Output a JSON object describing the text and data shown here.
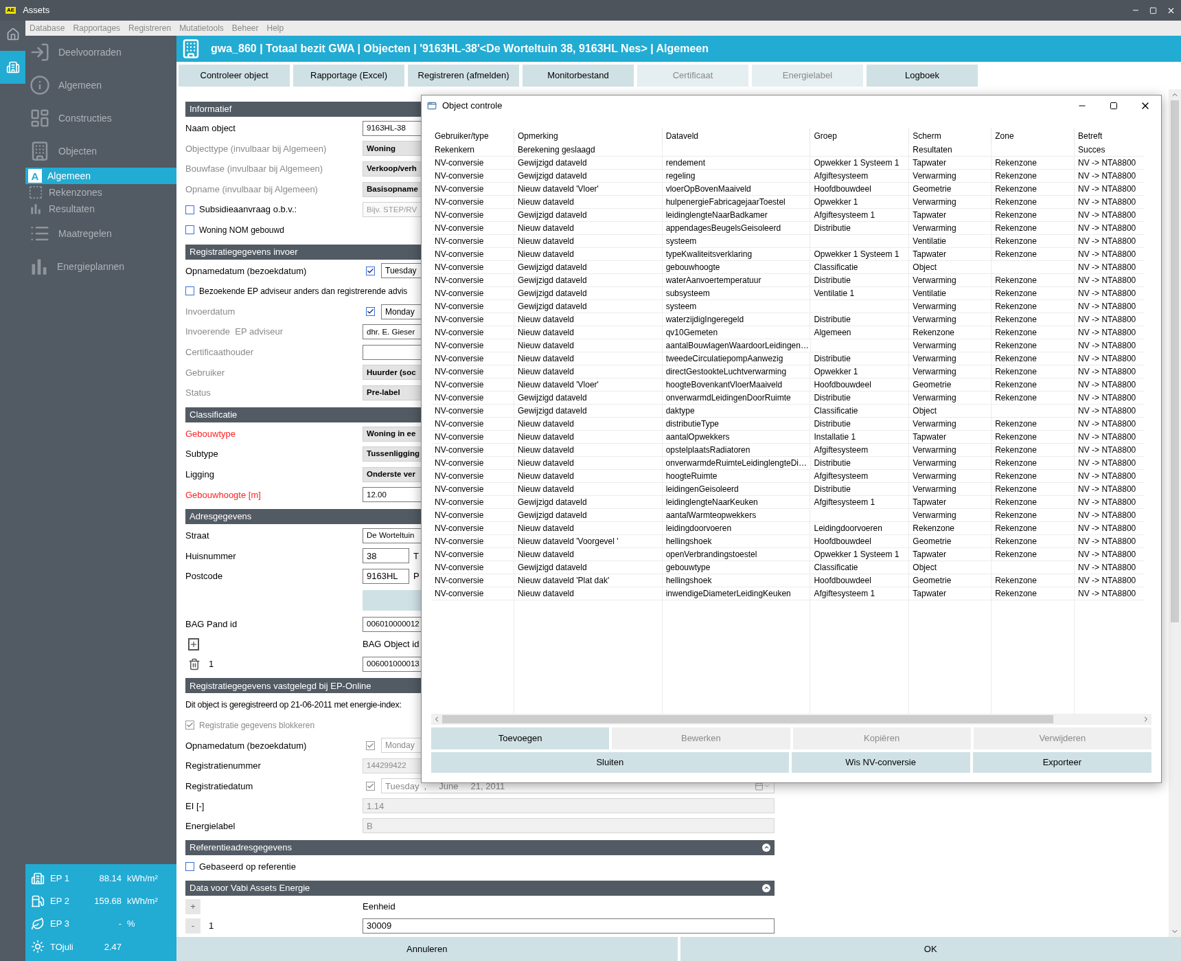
{
  "window": {
    "logo": "AE",
    "title": "Assets"
  },
  "menu": [
    "Database",
    "Rapportages",
    "Registreren",
    "Mutatietools",
    "Beheer",
    "Help"
  ],
  "nav_strip": [
    {
      "selected": false
    },
    {
      "selected": true
    }
  ],
  "sidebar": {
    "items": [
      {
        "label": "Deelvoorraden",
        "selected": false
      },
      {
        "label": "Algemeen",
        "selected": false
      },
      {
        "label": "Constructies",
        "selected": false
      },
      {
        "label": "Objecten",
        "selected": false,
        "children": [
          {
            "label": "Algemeen",
            "icon_letter": "A",
            "selected": true
          },
          {
            "label": "Rekenzones",
            "selected": false
          },
          {
            "label": "Resultaten",
            "selected": false
          }
        ]
      },
      {
        "label": "Maatregelen",
        "selected": false
      },
      {
        "label": "Energieplannen",
        "selected": false
      }
    ],
    "indicators": [
      {
        "label": "EP 1",
        "value": "88.14",
        "unit": "kWh/m²"
      },
      {
        "label": "EP 2",
        "value": "159.68",
        "unit": "kWh/m²"
      },
      {
        "label": "EP 3",
        "value": "-",
        "unit": "%"
      },
      {
        "label": "TOjuli",
        "value": "2.47"
      }
    ]
  },
  "header": {
    "title": "gwa_860 | Totaal bezit GWA | Objecten | '9163HL-38'<De Worteltuin 38, 9163HL Nes> | Algemeen"
  },
  "toolbar": [
    {
      "label": "Controleer object",
      "disabled": false
    },
    {
      "label": "Rapportage (Excel)",
      "disabled": false
    },
    {
      "label": "Registreren (afmelden)",
      "disabled": false
    },
    {
      "label": "Monitorbestand",
      "disabled": false
    },
    {
      "label": "Certificaat",
      "disabled": true
    },
    {
      "label": "Energielabel",
      "disabled": true
    },
    {
      "label": "Logboek",
      "disabled": false
    }
  ],
  "form": {
    "upper": [
      {
        "kind": "header",
        "title": "Informatief",
        "collapsible": false
      },
      {
        "kind": "text_field",
        "label": "Naam object",
        "required": false,
        "muted": false,
        "value": "9163HL-38"
      },
      {
        "kind": "select_field",
        "label": "Objecttype (invulbaar bij Algemeen)",
        "required": false,
        "muted": true,
        "value": "Woning"
      },
      {
        "kind": "select_field",
        "label": "Bouwfase (invulbaar bij Algemeen)",
        "required": false,
        "muted": true,
        "value": "Verkoop/verh"
      },
      {
        "kind": "select_field",
        "label": "Opname (invulbaar bij Algemeen)",
        "required": false,
        "muted": true,
        "value": "Basisopname"
      },
      {
        "kind": "check",
        "label": "Subsidieaanvraag o.b.v.:",
        "checked": false,
        "disabled": false,
        "placeholder": "Bijv. STEP/RV"
      },
      {
        "kind": "check",
        "label": "Woning NOM gebouwd",
        "checked": false,
        "disabled": false
      },
      {
        "kind": "header",
        "title": "Registratiegegevens invoer",
        "collapsible": false
      },
      {
        "kind": "date",
        "label": "Opnamedatum (bezoekdatum)",
        "required": false,
        "muted": false,
        "checked": true,
        "disabled": false,
        "value": "Tuesday"
      },
      {
        "kind": "check",
        "label": "Bezoekende EP adviseur anders dan registrerende advis",
        "checked": false,
        "disabled": false
      },
      {
        "kind": "date",
        "label": "Invoerdatum",
        "required": false,
        "muted": true,
        "checked": true,
        "disabled": false,
        "value": "Monday"
      },
      {
        "kind": "text_field",
        "label": "Invoerende  EP adviseur",
        "required": false,
        "muted": true,
        "value": "dhr. E. Gieser"
      },
      {
        "kind": "text_field",
        "label": "Certificaathouder",
        "required": false,
        "muted": true
      },
      {
        "kind": "select_field",
        "label": "Gebruiker",
        "required": false,
        "muted": true,
        "value": "Huurder (soc"
      },
      {
        "kind": "select_field",
        "label": "Status",
        "required": false,
        "muted": true,
        "value": "Pre-label"
      },
      {
        "kind": "header",
        "title": "Classificatie",
        "collapsible": false
      },
      {
        "kind": "select_field",
        "label": "Gebouwtype",
        "required": true,
        "muted": false,
        "value": "Woning in ee"
      },
      {
        "kind": "select_field",
        "label": "Subtype",
        "required": false,
        "muted": false,
        "value": "Tussenligging"
      },
      {
        "kind": "select_field",
        "label": "Ligging",
        "required": false,
        "muted": false,
        "value": "Onderste ver"
      },
      {
        "kind": "text_field",
        "label": "Gebouwhoogte [m]",
        "required": true,
        "muted": false,
        "value": "12.00"
      },
      {
        "kind": "header",
        "title": "Adresgegevens",
        "collapsible": false
      },
      {
        "kind": "text_field",
        "label": "Straat",
        "required": false,
        "muted": false,
        "value": "De Worteltuin"
      },
      {
        "kind": "short_field",
        "label": "Huisnummer",
        "required": false,
        "muted": false,
        "value": "38",
        "after": "T"
      },
      {
        "kind": "short_field",
        "label": "Postcode",
        "required": false,
        "muted": false,
        "value": "9163HL",
        "after": "P"
      },
      {
        "kind": "blank_button"
      },
      {
        "kind": "text_field",
        "label": "BAG Pand id",
        "required": false,
        "muted": false,
        "value": "006010000012"
      },
      {
        "kind": "add",
        "label": "BAG Object id"
      },
      {
        "kind": "remove",
        "label": "1",
        "value": "006001000013"
      },
      {
        "kind": "header",
        "title": "Registratiegegevens vastgelegd bij EP-Online",
        "collapsible": false
      },
      {
        "kind": "note",
        "text": "Dit object is geregistreerd op 21-06-2011 met energie-index:"
      },
      {
        "kind": "check",
        "label": "Registratie gegevens blokkeren",
        "checked": true,
        "disabled": true
      },
      {
        "kind": "date",
        "label": "Opnamedatum (bezoekdatum)",
        "required": false,
        "muted": false,
        "checked": true,
        "disabled": true,
        "value": "Monday"
      },
      {
        "kind": "readonly_field",
        "label": "Registratienummer",
        "required": false,
        "muted": false,
        "value": "144299422"
      }
    ],
    "lower": [
      {
        "kind": "date",
        "label": "Registratiedatum",
        "required": false,
        "muted": false,
        "checked": true,
        "disabled": true,
        "value": "Tuesday  ,     June     21, 2011"
      },
      {
        "kind": "readonly_field",
        "label": "EI [-]",
        "required": false,
        "muted": false,
        "value": "1.14"
      },
      {
        "kind": "readonly_field",
        "label": "Energielabel",
        "required": false,
        "muted": false,
        "value": "B"
      },
      {
        "kind": "header",
        "title": "Referentieadresgegevens",
        "collapsible": true
      },
      {
        "kind": "check",
        "label": "Gebaseerd op referentie",
        "checked": false,
        "disabled": false
      },
      {
        "kind": "header",
        "title": "Data voor Vabi Assets Energie",
        "collapsible": true
      },
      {
        "kind": "symbol_row",
        "symbol": "+",
        "label": "Eenheid"
      },
      {
        "kind": "symbol_row",
        "symbol": "-",
        "label": "1",
        "value": "30009"
      }
    ]
  },
  "footer": [
    "Annuleren",
    "OK"
  ],
  "dialog": {
    "title": "Object controle",
    "columns": [
      "Gebruiker/type",
      "Opmerking",
      "Dataveld",
      "Groep",
      "Scherm",
      "Zone",
      "Betreft"
    ],
    "rows": [
      {
        "gebruiker_type": "Rekenkern",
        "opmerking": "Berekening geslaagd",
        "scherm": "Resultaten",
        "betreft": "Succes"
      },
      {
        "gebruiker_type": "NV-conversie",
        "opmerking": "Gewijzigd dataveld",
        "dataveld": "rendement",
        "groep": "Opwekker 1 Systeem 1",
        "scherm": "Tapwater",
        "zone": "Rekenzone",
        "betreft": "NV -> NTA8800"
      },
      {
        "gebruiker_type": "NV-conversie",
        "opmerking": "Gewijzigd dataveld",
        "dataveld": "regeling",
        "groep": "Afgiftesysteem",
        "scherm": "Verwarming",
        "zone": "Rekenzone",
        "betreft": "NV -> NTA8800"
      },
      {
        "gebruiker_type": "NV-conversie",
        "opmerking": "Nieuw dataveld 'Vloer'",
        "dataveld": "vloerOpBovenMaaiveld",
        "groep": "Hoofdbouwdeel",
        "scherm": "Geometrie",
        "zone": "Rekenzone",
        "betreft": "NV -> NTA8800"
      },
      {
        "gebruiker_type": "NV-conversie",
        "opmerking": "Nieuw dataveld",
        "dataveld": "hulpenergieFabricagejaarToestel",
        "groep": "Opwekker 1",
        "scherm": "Verwarming",
        "zone": "Rekenzone",
        "betreft": "NV -> NTA8800"
      },
      {
        "gebruiker_type": "NV-conversie",
        "opmerking": "Gewijzigd dataveld",
        "dataveld": "leidinglengteNaarBadkamer",
        "groep": "Afgiftesysteem 1",
        "scherm": "Tapwater",
        "zone": "Rekenzone",
        "betreft": "NV -> NTA8800"
      },
      {
        "gebruiker_type": "NV-conversie",
        "opmerking": "Nieuw dataveld",
        "dataveld": "appendagesBeugelsGeisoleerd",
        "groep": "Distributie",
        "scherm": "Verwarming",
        "zone": "Rekenzone",
        "betreft": "NV -> NTA8800"
      },
      {
        "gebruiker_type": "NV-conversie",
        "opmerking": "Nieuw dataveld",
        "dataveld": "systeem",
        "scherm": "Ventilatie",
        "zone": "Rekenzone",
        "betreft": "NV -> NTA8800"
      },
      {
        "gebruiker_type": "NV-conversie",
        "opmerking": "Nieuw dataveld",
        "dataveld": "typeKwaliteitsverklaring",
        "groep": "Opwekker 1 Systeem 1",
        "scherm": "Tapwater",
        "zone": "Rekenzone",
        "betreft": "NV -> NTA8800"
      },
      {
        "gebruiker_type": "NV-conversie",
        "opmerking": "Gewijzigd dataveld",
        "dataveld": "gebouwhoogte",
        "groep": "Classificatie",
        "scherm": "Object",
        "betreft": "NV -> NTA8800"
      },
      {
        "gebruiker_type": "NV-conversie",
        "opmerking": "Gewijzigd dataveld",
        "dataveld": "waterAanvoertemperatuur",
        "groep": "Distributie",
        "scherm": "Verwarming",
        "zone": "Rekenzone",
        "betreft": "NV -> NTA8800"
      },
      {
        "gebruiker_type": "NV-conversie",
        "opmerking": "Gewijzigd dataveld",
        "dataveld": "subsysteem",
        "groep": "Ventilatie 1",
        "scherm": "Ventilatie",
        "zone": "Rekenzone",
        "betreft": "NV -> NTA8800"
      },
      {
        "gebruiker_type": "NV-conversie",
        "opmerking": "Gewijzigd dataveld",
        "dataveld": "systeem",
        "scherm": "Verwarming",
        "zone": "Rekenzone",
        "betreft": "NV -> NTA8800"
      },
      {
        "gebruiker_type": "NV-conversie",
        "opmerking": "Nieuw dataveld",
        "dataveld": "waterzijdigIngeregeld",
        "groep": "Distributie",
        "scherm": "Verwarming",
        "zone": "Rekenzone",
        "betreft": "NV -> NTA8800"
      },
      {
        "gebruiker_type": "NV-conversie",
        "opmerking": "Nieuw dataveld",
        "dataveld": "qv10Gemeten",
        "groep": "Algemeen",
        "scherm": "Rekenzone",
        "zone": "Rekenzone",
        "betreft": "NV -> NTA8800"
      },
      {
        "gebruiker_type": "NV-conversie",
        "opmerking": "Nieuw dataveld",
        "dataveld": "aantalBouwlagenWaardoorLeidingen…",
        "scherm": "Verwarming",
        "zone": "Rekenzone",
        "betreft": "NV -> NTA8800"
      },
      {
        "gebruiker_type": "NV-conversie",
        "opmerking": "Nieuw dataveld",
        "dataveld": "tweedeCirculatiepompAanwezig",
        "groep": "Distributie",
        "scherm": "Verwarming",
        "zone": "Rekenzone",
        "betreft": "NV -> NTA8800"
      },
      {
        "gebruiker_type": "NV-conversie",
        "opmerking": "Nieuw dataveld",
        "dataveld": "directGestookteLuchtverwarming",
        "groep": "Opwekker 1",
        "scherm": "Verwarming",
        "zone": "Rekenzone",
        "betreft": "NV -> NTA8800"
      },
      {
        "gebruiker_type": "NV-conversie",
        "opmerking": "Nieuw dataveld 'Vloer'",
        "dataveld": "hoogteBovenkantVloerMaaiveld",
        "groep": "Hoofdbouwdeel",
        "scherm": "Geometrie",
        "zone": "Rekenzone",
        "betreft": "NV -> NTA8800"
      },
      {
        "gebruiker_type": "NV-conversie",
        "opmerking": "Gewijzigd dataveld",
        "dataveld": "onverwarmdLeidingenDoorRuimte",
        "groep": "Distributie",
        "scherm": "Verwarming",
        "zone": "Rekenzone",
        "betreft": "NV -> NTA8800"
      },
      {
        "gebruiker_type": "NV-conversie",
        "opmerking": "Gewijzigd dataveld",
        "dataveld": "daktype",
        "groep": "Classificatie",
        "scherm": "Object",
        "betreft": "NV -> NTA8800"
      },
      {
        "gebruiker_type": "NV-conversie",
        "opmerking": "Nieuw dataveld",
        "dataveld": "distributieType",
        "groep": "Distributie",
        "scherm": "Verwarming",
        "zone": "Rekenzone",
        "betreft": "NV -> NTA8800"
      },
      {
        "gebruiker_type": "NV-conversie",
        "opmerking": "Nieuw dataveld",
        "dataveld": "aantalOpwekkers",
        "groep": "Installatie 1",
        "scherm": "Tapwater",
        "zone": "Rekenzone",
        "betreft": "NV -> NTA8800"
      },
      {
        "gebruiker_type": "NV-conversie",
        "opmerking": "Nieuw dataveld",
        "dataveld": "opstelplaatsRadiatoren",
        "groep": "Afgiftesysteem",
        "scherm": "Verwarming",
        "zone": "Rekenzone",
        "betreft": "NV -> NTA8800"
      },
      {
        "gebruiker_type": "NV-conversie",
        "opmerking": "Nieuw dataveld",
        "dataveld": "onverwarmdeRuimteLeidinglengteDi…",
        "groep": "Distributie",
        "scherm": "Verwarming",
        "zone": "Rekenzone",
        "betreft": "NV -> NTA8800"
      },
      {
        "gebruiker_type": "NV-conversie",
        "opmerking": "Nieuw dataveld",
        "dataveld": "hoogteRuimte",
        "groep": "Afgiftesysteem",
        "scherm": "Verwarming",
        "zone": "Rekenzone",
        "betreft": "NV -> NTA8800"
      },
      {
        "gebruiker_type": "NV-conversie",
        "opmerking": "Nieuw dataveld",
        "dataveld": "leidingenGeisoleerd",
        "groep": "Distributie",
        "scherm": "Verwarming",
        "zone": "Rekenzone",
        "betreft": "NV -> NTA8800"
      },
      {
        "gebruiker_type": "NV-conversie",
        "opmerking": "Gewijzigd dataveld",
        "dataveld": "leidinglengteNaarKeuken",
        "groep": "Afgiftesysteem 1",
        "scherm": "Tapwater",
        "zone": "Rekenzone",
        "betreft": "NV -> NTA8800"
      },
      {
        "gebruiker_type": "NV-conversie",
        "opmerking": "Gewijzigd dataveld",
        "dataveld": "aantalWarmteopwekkers",
        "scherm": "Verwarming",
        "zone": "Rekenzone",
        "betreft": "NV -> NTA8800"
      },
      {
        "gebruiker_type": "NV-conversie",
        "opmerking": "Nieuw dataveld",
        "dataveld": "leidingdoorvoeren",
        "groep": "Leidingdoorvoeren",
        "scherm": "Rekenzone",
        "zone": "Rekenzone",
        "betreft": "NV -> NTA8800"
      },
      {
        "gebruiker_type": "NV-conversie",
        "opmerking": "Nieuw dataveld 'Voorgevel '",
        "dataveld": "hellingshoek",
        "groep": "Hoofdbouwdeel",
        "scherm": "Geometrie",
        "zone": "Rekenzone",
        "betreft": "NV -> NTA8800"
      },
      {
        "gebruiker_type": "NV-conversie",
        "opmerking": "Nieuw dataveld",
        "dataveld": "openVerbrandingstoestel",
        "groep": "Opwekker 1 Systeem 1",
        "scherm": "Tapwater",
        "zone": "Rekenzone",
        "betreft": "NV -> NTA8800"
      },
      {
        "gebruiker_type": "NV-conversie",
        "opmerking": "Gewijzigd dataveld",
        "dataveld": "gebouwtype",
        "groep": "Classificatie",
        "scherm": "Object",
        "betreft": "NV -> NTA8800"
      },
      {
        "gebruiker_type": "NV-conversie",
        "opmerking": "Nieuw dataveld 'Plat dak'",
        "dataveld": "hellingshoek",
        "groep": "Hoofdbouwdeel",
        "scherm": "Geometrie",
        "zone": "Rekenzone",
        "betreft": "NV -> NTA8800"
      },
      {
        "gebruiker_type": "NV-conversie",
        "opmerking": "Nieuw dataveld",
        "dataveld": "inwendigeDiameterLeidingKeuken",
        "groep": "Afgiftesysteem 1",
        "scherm": "Tapwater",
        "zone": "Rekenzone",
        "betreft": "NV -> NTA8800"
      }
    ],
    "buttons": [
      {
        "label": "Toevoegen",
        "disabled": false
      },
      {
        "label": "Bewerken",
        "disabled": true
      },
      {
        "label": "Kopiëren",
        "disabled": true
      },
      {
        "label": "Verwijderen",
        "disabled": true
      }
    ],
    "actions": [
      {
        "label": "Sluiten",
        "wide": true
      },
      {
        "label": "Wis NV-conversie",
        "wide": false
      },
      {
        "label": "Exporteer",
        "wide": false
      }
    ]
  }
}
